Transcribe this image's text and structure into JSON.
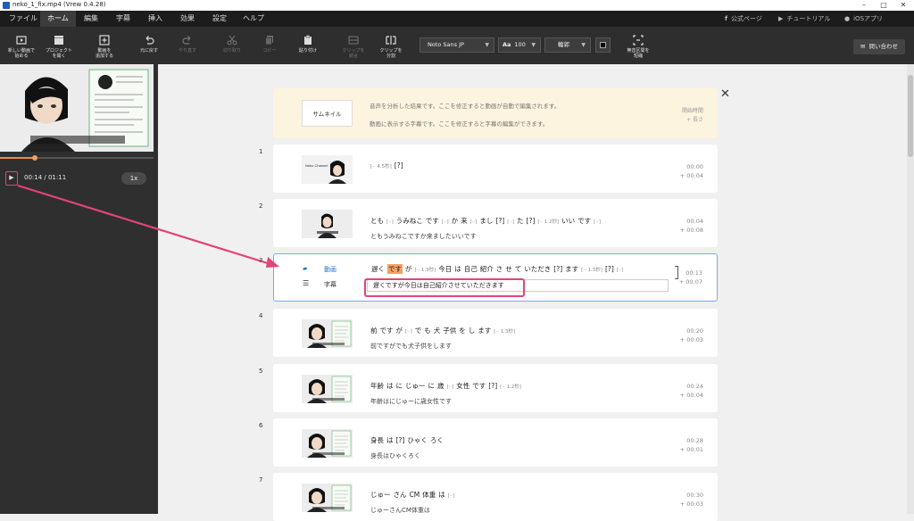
{
  "window": {
    "title": "neko_1_fix.mp4 (Vrew 0.4.28)",
    "controls": [
      "–",
      "□",
      "✕"
    ]
  },
  "menu": {
    "items": [
      "ファイル",
      "ホーム",
      "編集",
      "字幕",
      "挿入",
      "効果",
      "設定",
      "ヘルプ"
    ],
    "active": "ホーム",
    "links": [
      {
        "icon": "facebook-icon",
        "label": "公式ページ"
      },
      {
        "icon": "youtube-icon",
        "label": "チュートリアル"
      },
      {
        "icon": "apple-icon",
        "label": "iOSアプリ"
      }
    ]
  },
  "toolbar": {
    "new_video": "新しい動画で\n始める",
    "open_project": "プロジェクト\nを開く",
    "add_video": "動画を\n追加する",
    "undo": "元に戻す",
    "redo": "やり直す",
    "cut": "切り取り",
    "copy": "コピー",
    "paste": "貼り付け",
    "merge_clip": "クリップを\n結合",
    "split_clip": "クリップを\n分割",
    "font": "Noto Sans JP",
    "font_size": "100",
    "style": "輪郭",
    "silence": "無音区間を\n短縮",
    "contact": "問い合わせ"
  },
  "player": {
    "time": "00:14 / 01:11",
    "speed": "1x",
    "progress": 0.2
  },
  "legend": {
    "thumbnail": "サムネイル",
    "line1": "音声を分析した結果です。ここを修正すると動画が自動で編集されます。",
    "line2": "動画に表示する字幕です。ここを修正すると字幕の編集ができます。",
    "right1": "開始時間",
    "right2": "+ 長さ"
  },
  "clips": [
    {
      "num": "1",
      "words": [
        {
          "t": "[·· 4.5秒]",
          "p": true
        },
        {
          "t": "[?]"
        }
      ],
      "caption": "",
      "start": "00:00",
      "len": "+ 00:04"
    },
    {
      "num": "2",
      "words": [
        {
          "t": "とも"
        },
        {
          "t": "[··]",
          "p": true
        },
        {
          "t": "うみねこ"
        },
        {
          "t": "です"
        },
        {
          "t": "[··]",
          "p": true
        },
        {
          "t": "か"
        },
        {
          "t": "来"
        },
        {
          "t": "[··]",
          "p": true
        },
        {
          "t": "まし"
        },
        {
          "t": "[?]"
        },
        {
          "t": "[··]",
          "p": true
        },
        {
          "t": "た"
        },
        {
          "t": "[?]"
        },
        {
          "t": "[·· 1.2秒]",
          "p": true
        },
        {
          "t": "いい"
        },
        {
          "t": "です"
        },
        {
          "t": "[··]",
          "p": true
        }
      ],
      "caption": "ともうみねこですか来ましたいいです",
      "start": "00:04",
      "len": "+ 00:08"
    },
    {
      "num": "3",
      "selected": true,
      "video_label": "動画",
      "caption_label": "字幕",
      "words": [
        {
          "t": "遅く"
        },
        {
          "t": "です",
          "hl": true
        },
        {
          "t": "が"
        },
        {
          "t": "[·· 1.3秒]",
          "p": true
        },
        {
          "t": "今日"
        },
        {
          "t": "は"
        },
        {
          "t": "自己"
        },
        {
          "t": "紹介"
        },
        {
          "t": "さ"
        },
        {
          "t": "せ"
        },
        {
          "t": "て"
        },
        {
          "t": "いただき"
        },
        {
          "t": "[?]"
        },
        {
          "t": "ます"
        },
        {
          "t": "[·· 1.3秒]",
          "p": true
        },
        {
          "t": "[?]"
        },
        {
          "t": "[··]",
          "p": true
        }
      ],
      "caption": "遅くですが今日は自己紹介させていただきます",
      "start": "00:13",
      "len": "+ 00:07"
    },
    {
      "num": "4",
      "words": [
        {
          "t": "前"
        },
        {
          "t": "です"
        },
        {
          "t": "が"
        },
        {
          "t": "[··]",
          "p": true
        },
        {
          "t": "で"
        },
        {
          "t": "も"
        },
        {
          "t": "犬"
        },
        {
          "t": "子供"
        },
        {
          "t": "を"
        },
        {
          "t": "し"
        },
        {
          "t": "ます"
        },
        {
          "t": "[·· 1.3秒]",
          "p": true
        }
      ],
      "caption": "前ですがでも犬子供をします",
      "start": "00:20",
      "len": "+ 00:03"
    },
    {
      "num": "5",
      "words": [
        {
          "t": "年齢"
        },
        {
          "t": "は"
        },
        {
          "t": "に"
        },
        {
          "t": "じゅー"
        },
        {
          "t": "に"
        },
        {
          "t": "歳"
        },
        {
          "t": "[··]",
          "p": true
        },
        {
          "t": "女性"
        },
        {
          "t": "です"
        },
        {
          "t": "[?]"
        },
        {
          "t": "[·· 1.2秒]",
          "p": true
        }
      ],
      "caption": "年齢はにじゅーに歳女性です",
      "start": "00:24",
      "len": "+ 00:04"
    },
    {
      "num": "6",
      "words": [
        {
          "t": "身長"
        },
        {
          "t": "は"
        },
        {
          "t": "[?]"
        },
        {
          "t": "ひゃく"
        },
        {
          "t": "ろく"
        }
      ],
      "caption": "身長はひゃくろく",
      "start": "00:28",
      "len": "+ 00:01"
    },
    {
      "num": "7",
      "words": [
        {
          "t": "じゅー"
        },
        {
          "t": "さん"
        },
        {
          "t": "CM"
        },
        {
          "t": "体重"
        },
        {
          "t": "は"
        },
        {
          "t": "[··]",
          "p": true
        }
      ],
      "caption": "じゅーさんCM体重は",
      "start": "00:30",
      "len": "+ 00:03"
    }
  ]
}
